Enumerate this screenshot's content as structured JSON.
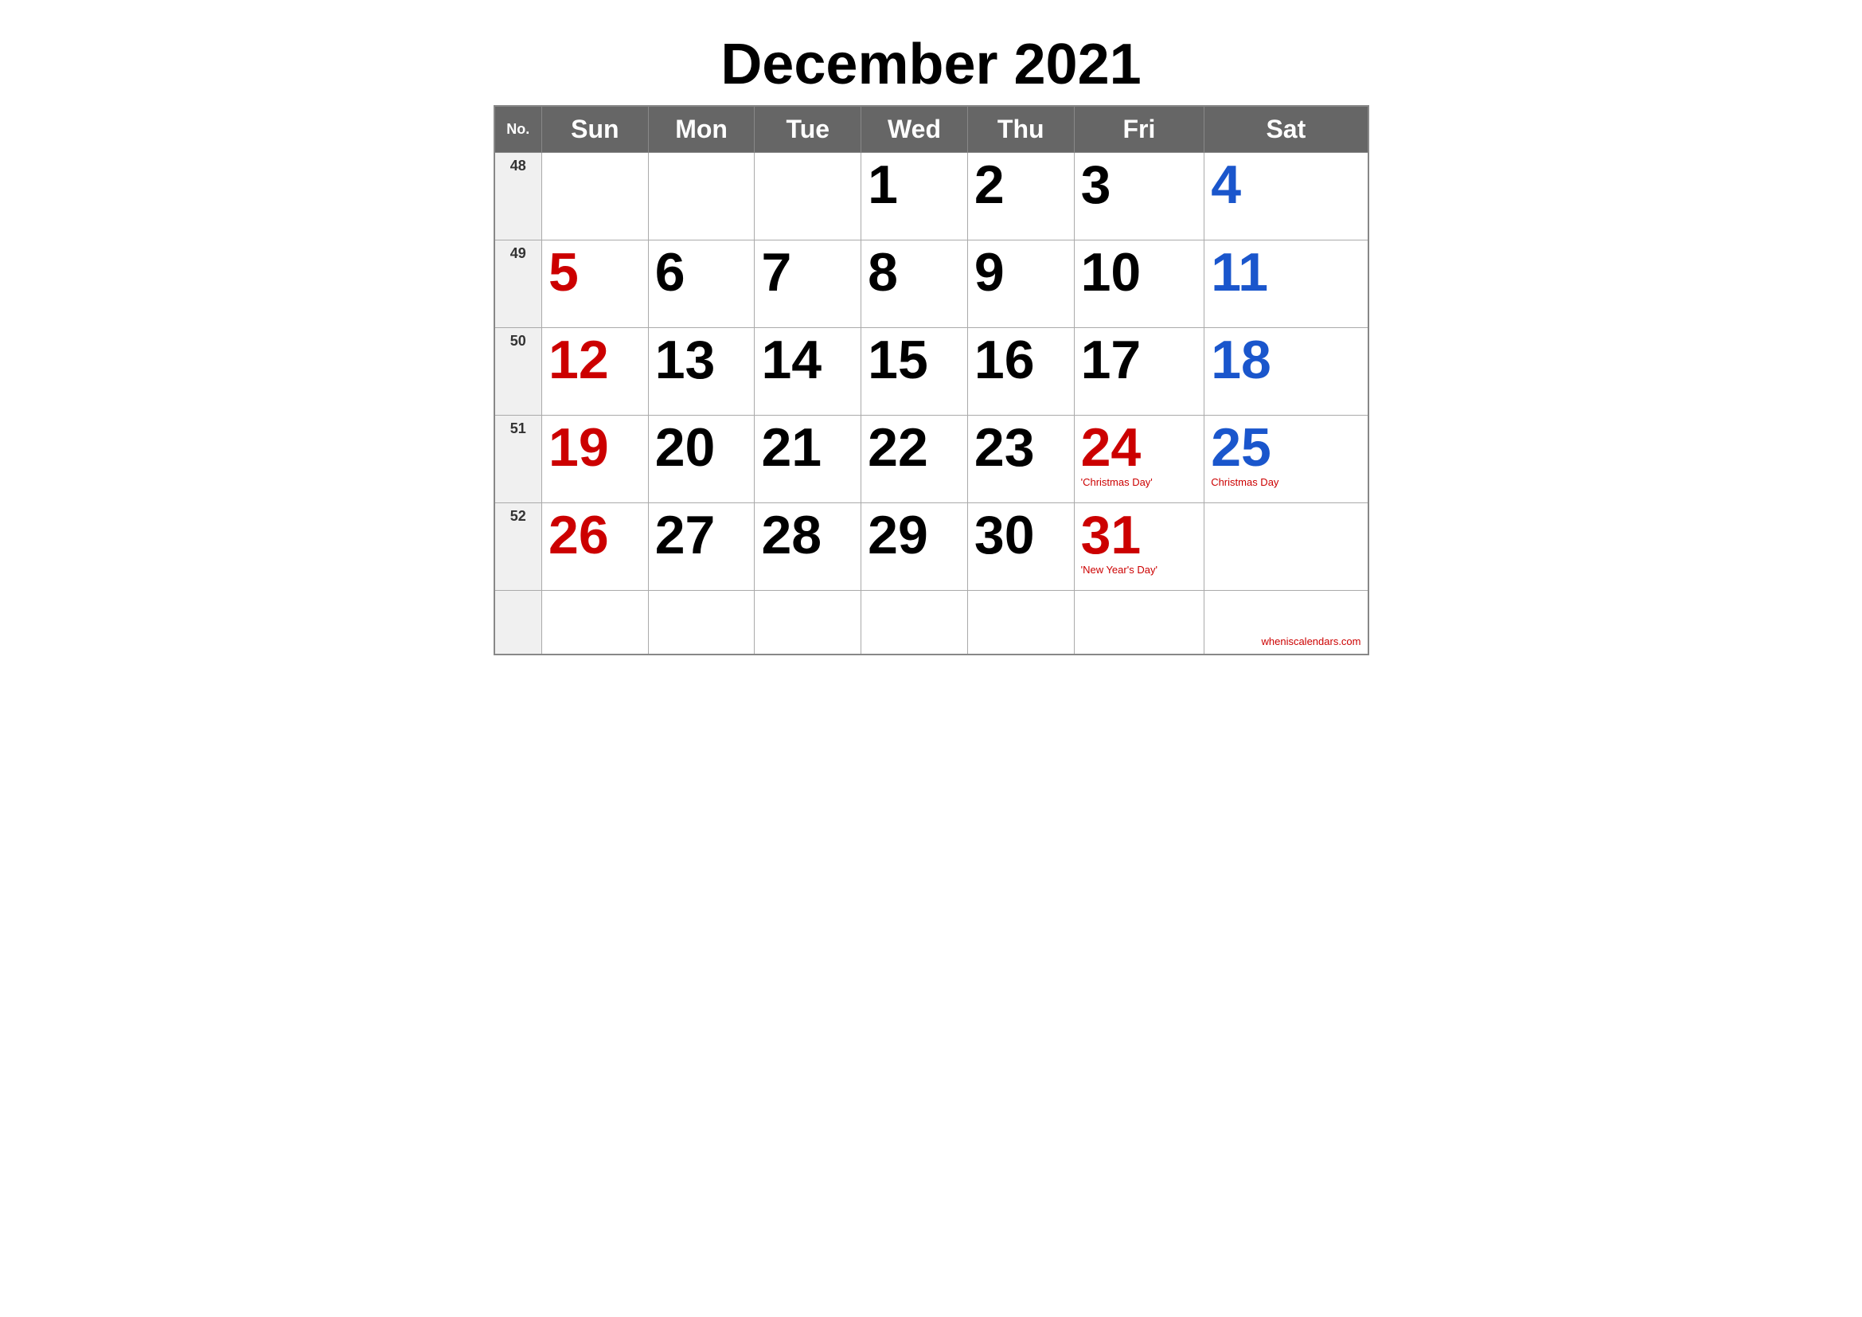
{
  "title": "December 2021",
  "header": {
    "no_col": "No.",
    "days": [
      "Sun",
      "Mon",
      "Tue",
      "Wed",
      "Thu",
      "Fri",
      "Sat"
    ]
  },
  "weeks": [
    {
      "week_no": "48",
      "days": [
        {
          "date": "",
          "color": "black"
        },
        {
          "date": "",
          "color": "black"
        },
        {
          "date": "",
          "color": "black"
        },
        {
          "date": "1",
          "color": "black"
        },
        {
          "date": "2",
          "color": "black"
        },
        {
          "date": "3",
          "color": "black"
        },
        {
          "date": "4",
          "color": "blue"
        }
      ]
    },
    {
      "week_no": "49",
      "days": [
        {
          "date": "5",
          "color": "red"
        },
        {
          "date": "6",
          "color": "black"
        },
        {
          "date": "7",
          "color": "black"
        },
        {
          "date": "8",
          "color": "black"
        },
        {
          "date": "9",
          "color": "black"
        },
        {
          "date": "10",
          "color": "black"
        },
        {
          "date": "11",
          "color": "blue"
        }
      ]
    },
    {
      "week_no": "50",
      "days": [
        {
          "date": "12",
          "color": "red"
        },
        {
          "date": "13",
          "color": "black"
        },
        {
          "date": "14",
          "color": "black"
        },
        {
          "date": "15",
          "color": "black"
        },
        {
          "date": "16",
          "color": "black"
        },
        {
          "date": "17",
          "color": "black"
        },
        {
          "date": "18",
          "color": "blue"
        }
      ]
    },
    {
      "week_no": "51",
      "days": [
        {
          "date": "19",
          "color": "red"
        },
        {
          "date": "20",
          "color": "black"
        },
        {
          "date": "21",
          "color": "black"
        },
        {
          "date": "22",
          "color": "black"
        },
        {
          "date": "23",
          "color": "black"
        },
        {
          "date": "24",
          "color": "red",
          "holiday": "'Christmas Day'"
        },
        {
          "date": "25",
          "color": "blue",
          "holiday": "Christmas Day"
        }
      ]
    },
    {
      "week_no": "52",
      "days": [
        {
          "date": "26",
          "color": "red"
        },
        {
          "date": "27",
          "color": "black"
        },
        {
          "date": "28",
          "color": "black"
        },
        {
          "date": "29",
          "color": "black"
        },
        {
          "date": "30",
          "color": "black"
        },
        {
          "date": "31",
          "color": "red",
          "holiday": "'New Year's Day'"
        },
        {
          "date": "",
          "color": "black"
        }
      ]
    },
    {
      "week_no": "",
      "days": [
        {
          "date": "",
          "color": "black"
        },
        {
          "date": "",
          "color": "black"
        },
        {
          "date": "",
          "color": "black"
        },
        {
          "date": "",
          "color": "black"
        },
        {
          "date": "",
          "color": "black"
        },
        {
          "date": "",
          "color": "black"
        },
        {
          "date": "",
          "color": "black",
          "watermark": "wheniscalendars.com"
        }
      ]
    }
  ]
}
